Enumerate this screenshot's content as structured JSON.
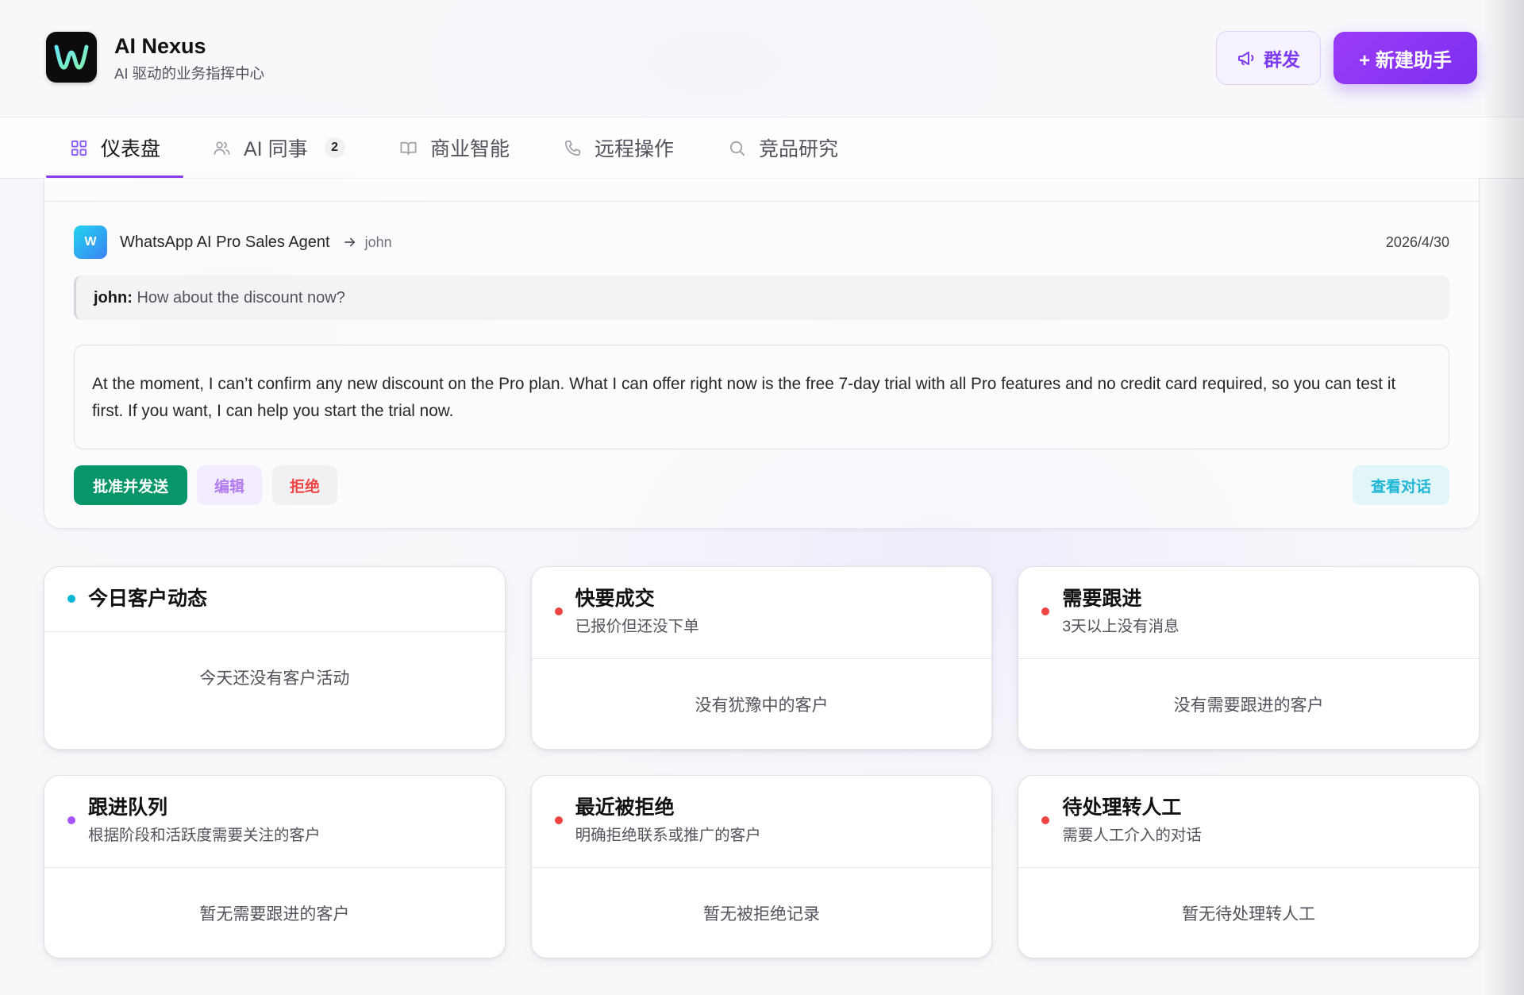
{
  "app": {
    "name": "AI Nexus",
    "tagline": "AI 驱动的业务指挥中心",
    "logo_icon": "waveform-w-logo"
  },
  "header_actions": {
    "broadcast": {
      "label": "群发",
      "icon": "megaphone-icon"
    },
    "new_assistant": {
      "label": "+ 新建助手"
    }
  },
  "tabs": [
    {
      "label": "仪表盘",
      "icon": "grid-icon",
      "active": true
    },
    {
      "label": "AI 同事",
      "icon": "users-icon",
      "badge": "2"
    },
    {
      "label": "商业智能",
      "icon": "book-open-icon"
    },
    {
      "label": "远程操作",
      "icon": "phone-icon"
    },
    {
      "label": "竞品研究",
      "icon": "search-icon"
    }
  ],
  "approval_card": {
    "agent_avatar": "W",
    "agent_name": "WhatsApp AI Pro Sales Agent",
    "recipient": "john",
    "date": "2026/4/30",
    "incoming": {
      "speaker": "john:",
      "text": "How about the discount now?"
    },
    "draft_reply": "At the moment, I can’t confirm any new discount on the Pro plan. What I can offer right now is the free 7-day trial with all Pro features and no credit card required, so you can test it first. If you want, I can help you start the trial now.",
    "actions": {
      "approve": "批准并发送",
      "edit": "编辑",
      "reject": "拒绝",
      "view_conversation": "查看对话"
    }
  },
  "panels": [
    {
      "title": "今日客户动态",
      "empty_text": "今天还没有客户活动",
      "dot_color": "#06b6d4"
    },
    {
      "title": "快要成交",
      "subtitle": "已报价但还没下单",
      "empty_text": "没有犹豫中的客户",
      "dot_color": "#ef4444"
    },
    {
      "title": "需要跟进",
      "subtitle": "3天以上没有消息",
      "empty_text": "没有需要跟进的客户",
      "dot_color": "#ef4444"
    },
    {
      "title": "跟进队列",
      "subtitle": "根据阶段和活跃度需要关注的客户",
      "empty_text": "暂无需要跟进的客户",
      "dot_color": "#a855f7"
    },
    {
      "title": "最近被拒绝",
      "subtitle": "明确拒绝联系或推广的客户",
      "empty_text": "暂无被拒绝记录",
      "dot_color": "#ef4444"
    },
    {
      "title": "待处理转人工",
      "subtitle": "需要人工介入的对话",
      "empty_text": "暂无待处理转人工",
      "dot_color": "#ef4444"
    }
  ],
  "colors": {
    "accent": "#7c3aed",
    "approve": "#079669",
    "reject": "#ef4444",
    "info": "#06b6d4"
  }
}
